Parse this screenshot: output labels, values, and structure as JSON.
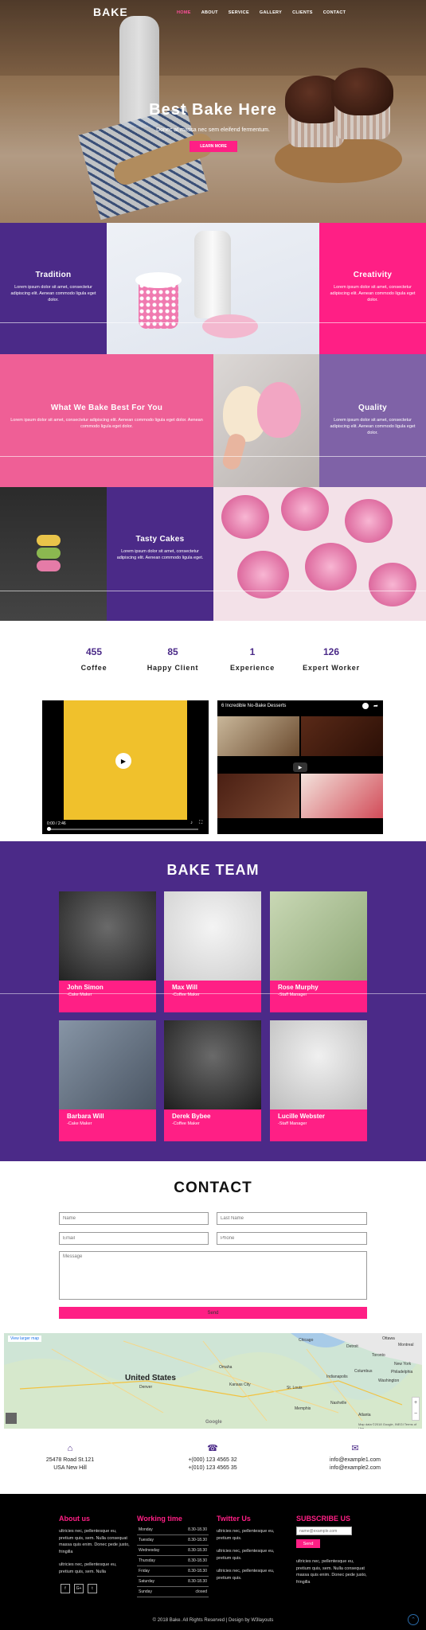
{
  "nav": {
    "logo": "BAKE",
    "items": [
      {
        "label": "HOME",
        "active": true
      },
      {
        "label": "ABOUT"
      },
      {
        "label": "SERVICE"
      },
      {
        "label": "GALLERY"
      },
      {
        "label": "CLIENTS"
      },
      {
        "label": "CONTACT"
      }
    ]
  },
  "hero": {
    "title": "Best Bake Here",
    "subtitle": "Donec at massa nec sem eleifend fermentum.",
    "button": "LEARN MORE"
  },
  "features": {
    "tradition": {
      "title": "Tradition",
      "text": "Lorem ipsum dolor sit amet, consectetur adipiscing elit. Aenean commodo ligula eget dolor."
    },
    "creativity": {
      "title": "Creativity",
      "text": "Lorem ipsum dolor sit amet, consectetur adipiscing elit. Aenean commodo ligula eget dolor."
    },
    "best": {
      "title": "What We Bake Best For You",
      "text": "Lorem ipsum dolor sit amet, consectetur adipiscing elit. Aenean commodo ligula eget dolor. Aenean commodo ligula eget dolor."
    },
    "quality": {
      "title": "Quality",
      "text": "Lorem ipsum dolor sit amet, consectetur adipiscing elit. Aenean commodo ligula eget dolor."
    },
    "tasty": {
      "title": "Tasty Cakes",
      "text": "Lorem ipsum dolor sit amet, consectetur adipiscing elit. Aenean commodo ligula eget."
    }
  },
  "stats": [
    {
      "num": "455",
      "label": "Coffee"
    },
    {
      "num": "85",
      "label": "Happy Client"
    },
    {
      "num": "1",
      "label": "Experience"
    },
    {
      "num": "126",
      "label": "Expert Worker"
    }
  ],
  "videos": {
    "left_time": "0:00 / 2:46",
    "right_title": "6 Incredible No-Bake Desserts"
  },
  "team": {
    "title": "BAKE TEAM",
    "members": [
      {
        "name": "John Simon",
        "role": "-Cake Maker"
      },
      {
        "name": "Max Will",
        "role": "-Coffee Maker"
      },
      {
        "name": "Rose Murphy",
        "role": "-Staff Manager"
      },
      {
        "name": "Barbara Will",
        "role": "-Cake Maker"
      },
      {
        "name": "Derek Bybee",
        "role": "-Coffee Maker"
      },
      {
        "name": "Lucille Webster",
        "role": "-Staff Manager"
      }
    ]
  },
  "contact": {
    "title": "CONTACT",
    "name_placeholder": "Name",
    "lastname_placeholder": "Last Name",
    "email_placeholder": "Email",
    "phone_placeholder": "Phone",
    "message_placeholder": "Message",
    "send": "Send"
  },
  "map": {
    "label": "United States",
    "view_larger": "View larger map",
    "cities": [
      "Chicago",
      "Detroit",
      "Omaha",
      "Kansas City",
      "St. Louis",
      "Nashville",
      "Memphis",
      "Atlanta",
      "Ottawa",
      "Montreal",
      "Toronto",
      "New York",
      "Philadelphia",
      "Washington",
      "Indianapolis",
      "Columbus",
      "Denver"
    ],
    "google": "Google",
    "footer_note": "Map data ©2018 Google, INEGI   Terms of Use"
  },
  "address": {
    "col1": [
      "25478 Road St.121",
      "USA New Hill"
    ],
    "col2": [
      "+(000) 123 4565 32",
      "+(010) 123 4565 35"
    ],
    "col3": [
      "info@example1.com",
      "info@example2.com"
    ]
  },
  "footer": {
    "about": {
      "title": "About us",
      "p1": "ultricies nec, pellentesque eu, pretium quis, sem. Nulla consequat massa quis enim. Donec pede justo, fringilla",
      "p2": "ultricies nec, pellentesque eu, pretium quis, sem. Nulla"
    },
    "working": {
      "title": "Working time",
      "rows": [
        {
          "day": "Monday",
          "time": "8.30-18.30"
        },
        {
          "day": "Tuesday",
          "time": "8.30-18.30"
        },
        {
          "day": "Wednesday",
          "time": "8.30-18.30"
        },
        {
          "day": "Thursday",
          "time": "8.30-18.30"
        },
        {
          "day": "Friday",
          "time": "8.30-18.30"
        },
        {
          "day": "Saturday",
          "time": "8.30-18.30"
        },
        {
          "day": "Sunday",
          "time": "closed"
        }
      ]
    },
    "twitter": {
      "title": "Twitter Us",
      "p1": "ultricies nec, pellentesque eu, pretium quis.",
      "p2": "ultricies nec, pellentesque eu, pretium quis.",
      "p3": "ultricies nec, pellentesque eu, pretium quis."
    },
    "subscribe": {
      "title": "SUBSCRIBE US",
      "placeholder": "name@example.com",
      "button": "Send",
      "text": "ultricies nec, pellentesque eu, pretium quis, sem. Nulla consequat massa quis enim. Donec pede justo, fringilla"
    },
    "social": [
      "f",
      "G+",
      "t"
    ],
    "copyright": "© 2018 Bake. All Rights Reserved | Design by W3layouts"
  },
  "colors": {
    "purple": "#4b2a88",
    "pink": "#ff1f85",
    "rose": "#ef5f96",
    "lilac": "#7f62a7"
  }
}
